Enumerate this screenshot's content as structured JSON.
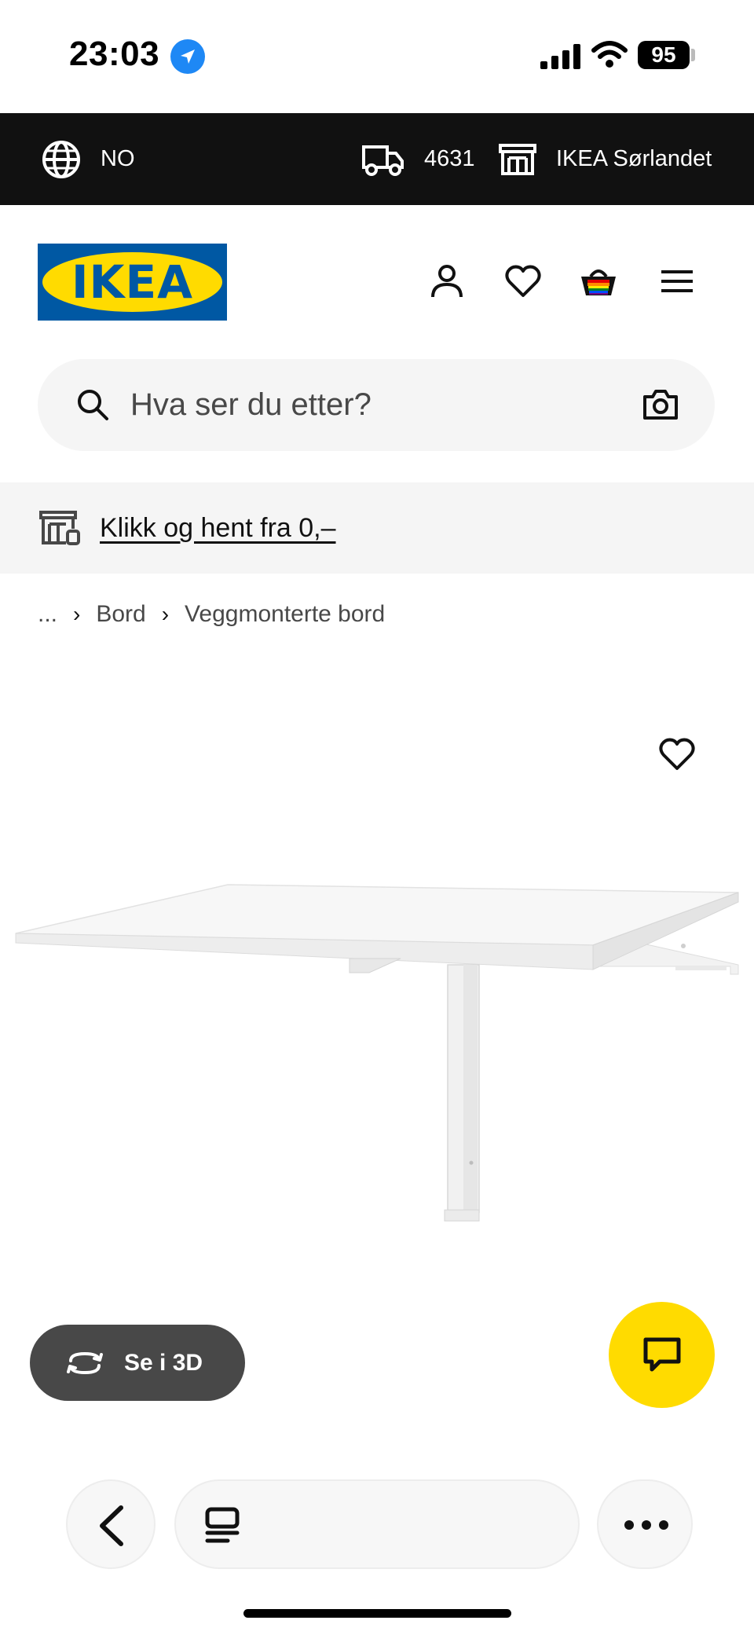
{
  "status_bar": {
    "time": "23:03",
    "battery": "95"
  },
  "top_bar": {
    "country": "NO",
    "postal_code": "4631",
    "store": "IKEA Sørlandet"
  },
  "header": {
    "logo_text": "IKEA",
    "icons": [
      "user-icon",
      "heart-icon",
      "shopping-bag-icon",
      "menu-icon"
    ]
  },
  "search": {
    "placeholder": "Hva ser du etter?"
  },
  "banner": {
    "link_text": "Klikk og hent fra 0,–"
  },
  "breadcrumb": {
    "items": [
      "...",
      "Bord",
      "Veggmonterte bord"
    ]
  },
  "product": {
    "view_3d_label": "Se i 3D"
  },
  "colors": {
    "ikea_blue": "#0058a3",
    "ikea_yellow": "#ffdb00",
    "top_bar": "#111111",
    "button_dark": "#484848"
  }
}
